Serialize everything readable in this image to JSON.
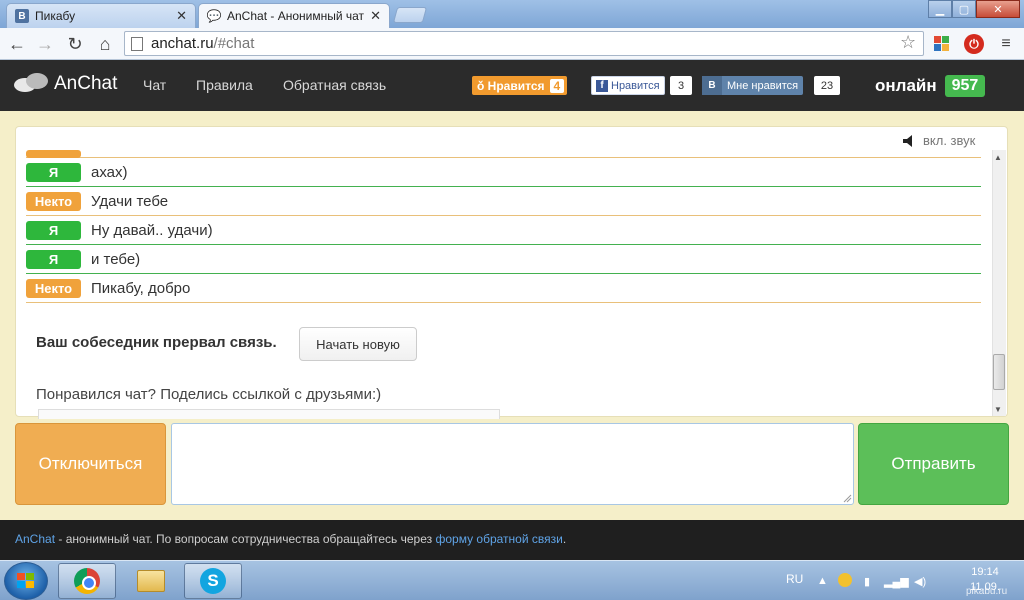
{
  "browser": {
    "tabs": [
      {
        "label": "Пикабу",
        "icon": "vk-favicon",
        "active": false
      },
      {
        "label": "AnChat - Анонимный чат",
        "icon": "chat-favicon",
        "active": true
      }
    ],
    "url_host": "anchat.ru",
    "url_path": "/#chat"
  },
  "site": {
    "logo": "AnChat",
    "nav": [
      "Чат",
      "Правила",
      "Обратная связь"
    ],
    "social": {
      "ok_label": "Нравится",
      "ok_count": "4",
      "fb_label": "Нравится",
      "fb_count": "3",
      "vk_label": "Мне нравится",
      "vk_count": "23"
    },
    "online_label": "онлайн",
    "online_count": "957"
  },
  "chat": {
    "sound_toggle": "вкл. звук",
    "messages": [
      {
        "author": "Я",
        "role": "me",
        "text": "ахах)"
      },
      {
        "author": "Некто",
        "role": "stranger",
        "text": "Удачи тебе"
      },
      {
        "author": "Я",
        "role": "me",
        "text": "Ну давай.. удачи)"
      },
      {
        "author": "Я",
        "role": "me",
        "text": "и тебе)"
      },
      {
        "author": "Некто",
        "role": "stranger",
        "text": "Пикабу, добро"
      }
    ],
    "end_notice": "Ваш собеседник прервал связь.",
    "new_chat_button": "Начать новую",
    "share_prompt": "Понравился чат? Поделись ссылкой с друзьями:)"
  },
  "controls": {
    "disconnect_button": "Отключиться",
    "send_button": "Отправить",
    "input_value": ""
  },
  "footer": {
    "brand": "AnChat",
    "text": " - анонимный чат. По вопросам сотрудничества обращайтесь через ",
    "link": "форму обратной связи",
    "end": "."
  },
  "taskbar": {
    "apps": [
      "chrome-icon",
      "explorer-folder-icon",
      "skype-icon"
    ],
    "language": "RU",
    "time": "19:14",
    "date": "11.09."
  },
  "watermark": "pikabu.ru",
  "colors": {
    "me_badge": "#2eb73c",
    "stranger_badge": "#f0a23b",
    "disconnect": "#f0ad52",
    "send": "#5cbf59",
    "online_badge": "#45b94f",
    "page_bg": "#f5efc9",
    "header_bg": "#2b2b2b"
  }
}
